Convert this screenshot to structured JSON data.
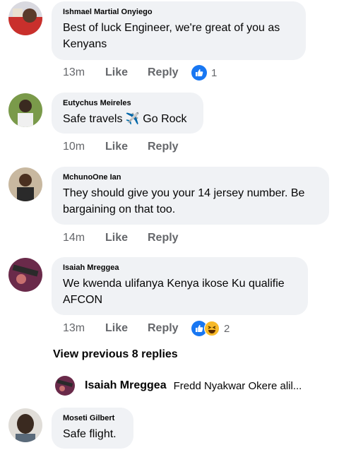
{
  "comments": [
    {
      "author": "Ishmael Martial Onyiego",
      "text": "Best of luck Engineer, we're great of you as Kenyans",
      "time": "13m",
      "like": "Like",
      "reply": "Reply",
      "reactions": "1",
      "avatar_color": "#c9302c"
    },
    {
      "author": "Eutychus Meireles",
      "text": "Safe travels ✈️ Go Rock",
      "time": "10m",
      "like": "Like",
      "reply": "Reply",
      "avatar_color": "#6b8e3a"
    },
    {
      "author": "MchunoOne Ian",
      "text": "They should give you your 14 jersey number. Be bargaining on that too.",
      "time": "14m",
      "like": "Like",
      "reply": "Reply",
      "avatar_color": "#7a5a45"
    },
    {
      "author": "Isaiah Mreggea",
      "text": "We kwenda ulifanya Kenya ikose Ku qualifie AFCON",
      "time": "13m",
      "like": "Like",
      "reply": "Reply",
      "reactions": "2",
      "avatar_color": "#8a2a5a"
    },
    {
      "author": "Moseti Gilbert",
      "text": "Safe flight.",
      "avatar_color": "#4a3a30"
    }
  ],
  "view_previous": "View previous 8 replies",
  "reply_preview": {
    "author": "Isaiah Mreggea",
    "text": "Fredd Nyakwar Okere alil..."
  },
  "colors": {
    "bubble": "#f0f2f5",
    "meta": "#65676b",
    "like_blue": "#1877f2",
    "haha_yellow": "#f7b928"
  }
}
